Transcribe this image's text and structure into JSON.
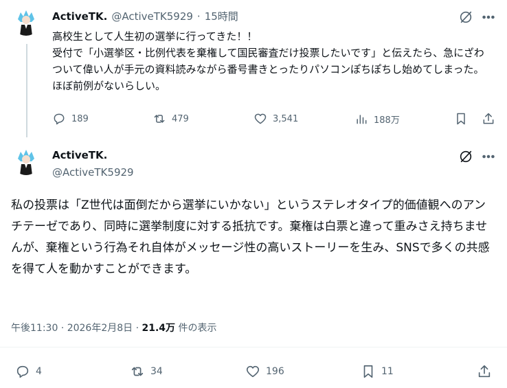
{
  "tweet1": {
    "name": "ActiveTK.",
    "handle": "@ActiveTK5929",
    "time": "15時間",
    "body": "高校生として人生初の選挙に行ってきた！！\n受付で「小選挙区・比例代表を棄権して国民審査だけ投票したいです」と伝えたら、急にざわついて偉い人が手元の資料読みながら番号書きとったりパソコンぽちぽちし始めてしまった。ほぼ前例がないらしい。",
    "replies": "189",
    "reposts": "479",
    "likes": "3,541",
    "views": "188万"
  },
  "tweet2": {
    "name": "ActiveTK.",
    "handle": "@ActiveTK5929",
    "body": "私の投票は「Z世代は面倒だから選挙にいかない」というステレオタイプ的価値観へのアンチテーゼであり、同時に選挙制度に対する抵抗です。棄権は白票と違って重みさえ持ちませんが、棄権という行為それ自体がメッセージ性の高いストーリーを生み、SNSで多くの共感を得て人を動かすことができます。",
    "timestamp": "午後11:30 · 2026年2月8日 · ",
    "views_count": "21.4万",
    "views_label": " 件の表示",
    "replies": "4",
    "reposts": "34",
    "likes": "196",
    "bookmarks": "11"
  },
  "icons": {
    "grok": "grok-icon",
    "more": "more-icon",
    "reply": "reply-icon",
    "repost": "repost-icon",
    "like": "like-icon",
    "views": "views-icon",
    "bookmark": "bookmark-icon",
    "share": "share-icon"
  },
  "colors": {
    "text": "#0f1419",
    "secondary": "#536471",
    "divider": "#eff3f4",
    "avatar_hair": "#5fc3e8"
  }
}
